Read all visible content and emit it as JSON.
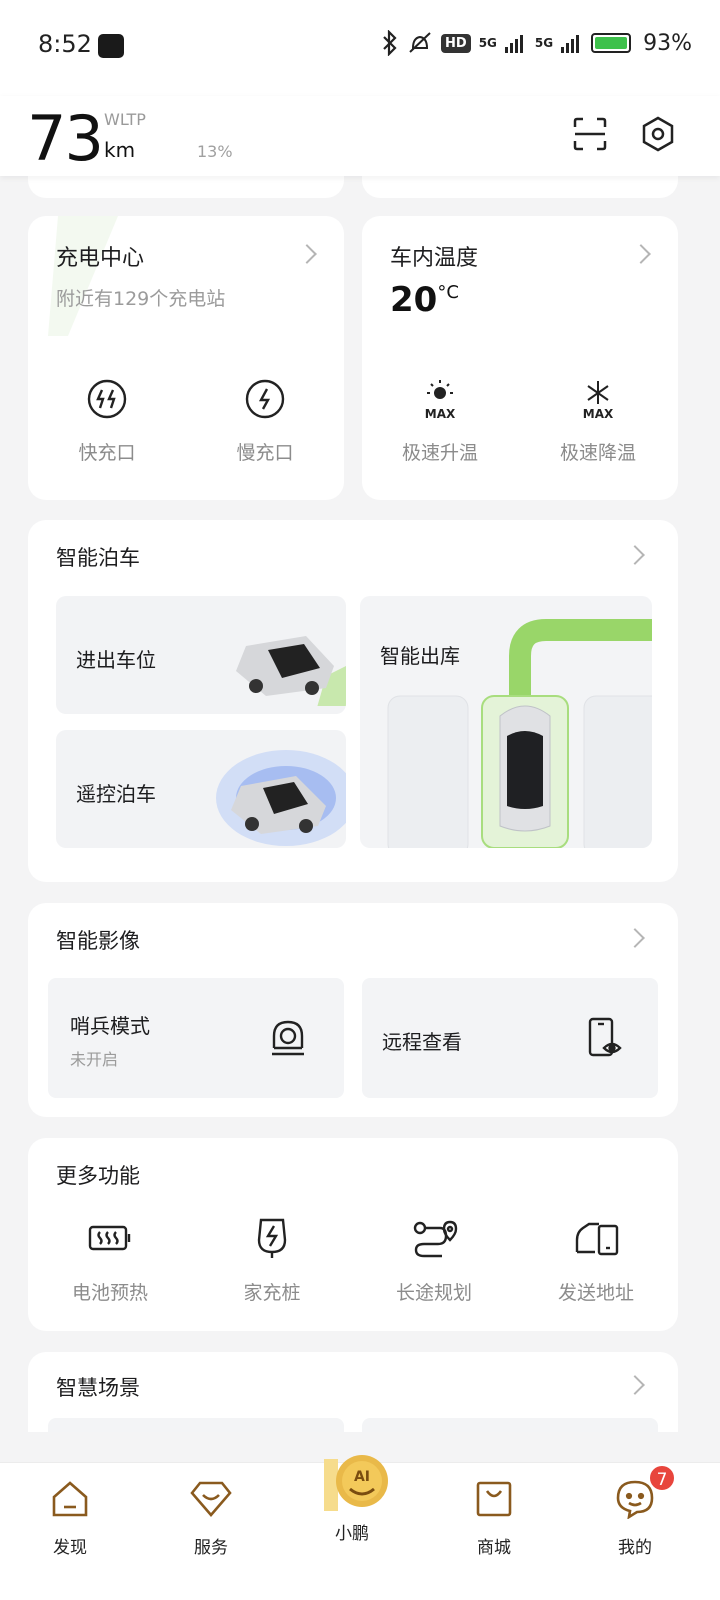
{
  "status_bar": {
    "time": "8:52",
    "hd": "HD",
    "net1": "5G",
    "net2": "5G",
    "battery_pct": "93%",
    "battery_level": 0.93
  },
  "header": {
    "range_value": "73",
    "range_standard": "WLTP",
    "range_unit": "km",
    "soc": "13%"
  },
  "charging": {
    "title": "充电中心",
    "subtitle": "附近有129个充电站",
    "fast_port": "快充口",
    "slow_port": "慢充口"
  },
  "climate": {
    "title": "车内温度",
    "temp": "20",
    "unit": "°C",
    "max_label": "MAX",
    "heat": "极速升温",
    "cool": "极速降温"
  },
  "parking": {
    "title": "智能泊车",
    "park_in_out": "进出车位",
    "remote_park": "遥控泊车",
    "smart_exit": "智能出库"
  },
  "camera": {
    "title": "智能影像",
    "sentry": "哨兵模式",
    "sentry_status": "未开启",
    "remote_view": "远程查看"
  },
  "more": {
    "title": "更多功能",
    "items": [
      "电池预热",
      "家充桩",
      "长途规划",
      "发送地址"
    ]
  },
  "scenes": {
    "title": "智慧场景"
  },
  "tabbar": {
    "items": [
      "发现",
      "服务",
      "小鹏",
      "商城",
      "我的"
    ],
    "badge": "7",
    "ai_text": "AI"
  },
  "colors": {
    "accent_brown": "#8a5a1e",
    "gold": "#e9b949",
    "green": "#7cc94a",
    "badge_red": "#e8453c"
  }
}
